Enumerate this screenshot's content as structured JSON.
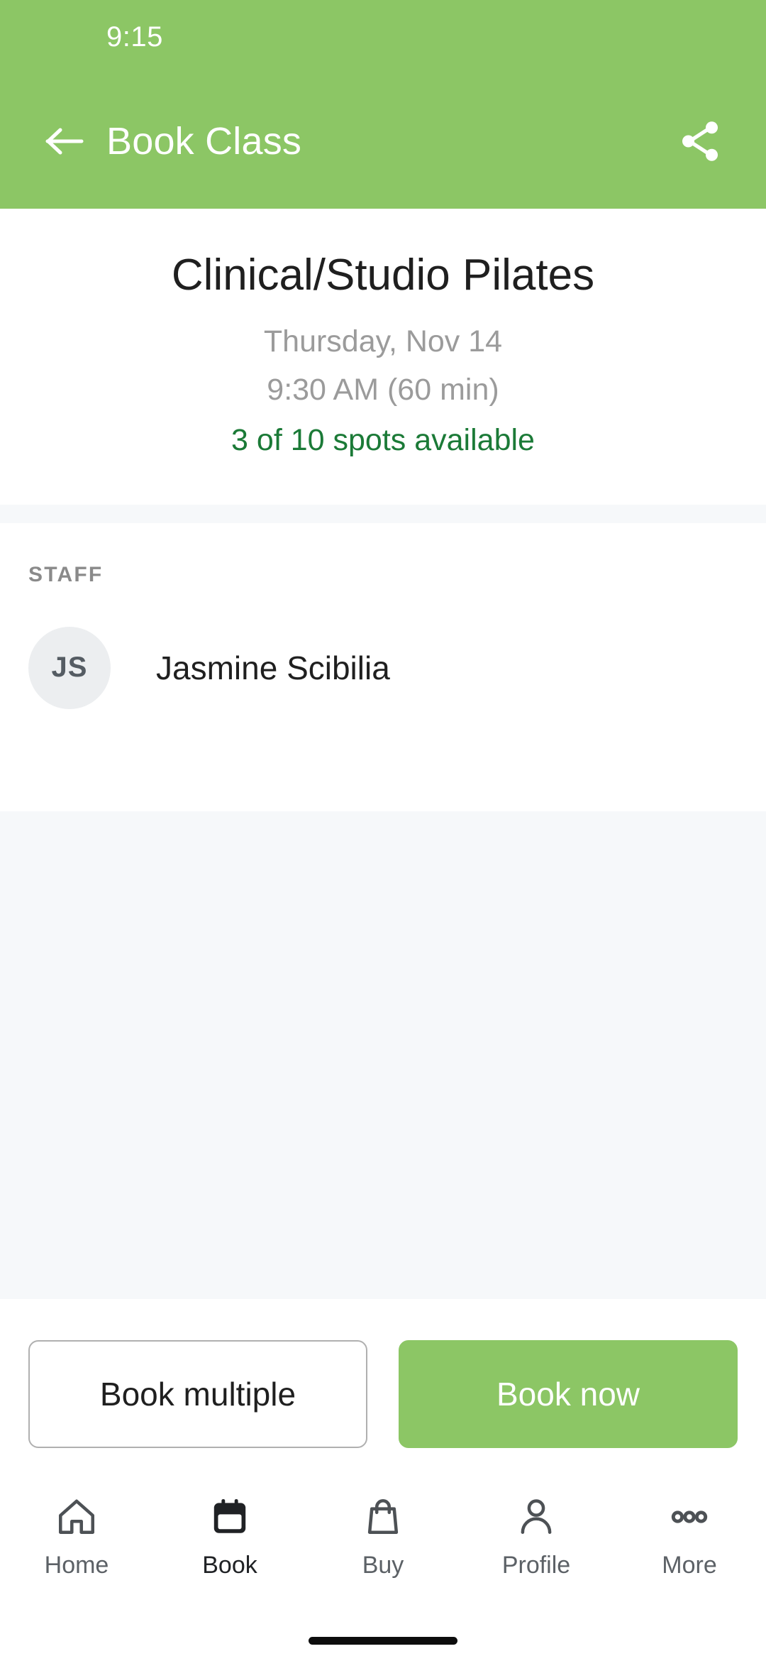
{
  "status_bar": {
    "time": "9:15"
  },
  "app_bar": {
    "back_icon": "arrow-left-icon",
    "title": "Book Class",
    "share_icon": "share-icon",
    "background_color": "#8CC665"
  },
  "class": {
    "title": "Clinical/Studio Pilates",
    "date": "Thursday, Nov 14",
    "time": "9:30 AM (60 min)",
    "availability": "3 of 10 spots available",
    "availability_color": "#1B7A37"
  },
  "staff": {
    "section_label": "STAFF",
    "members": [
      {
        "initials": "JS",
        "name": "Jasmine Scibilia"
      }
    ]
  },
  "actions": {
    "secondary_label": "Book multiple",
    "primary_label": "Book now",
    "primary_color": "#8CC665"
  },
  "bottom_nav": {
    "items": [
      {
        "label": "Home",
        "icon": "home-icon",
        "active": false
      },
      {
        "label": "Book",
        "icon": "calendar-icon",
        "active": true
      },
      {
        "label": "Buy",
        "icon": "shopping-bag-icon",
        "active": false
      },
      {
        "label": "Profile",
        "icon": "person-icon",
        "active": false
      },
      {
        "label": "More",
        "icon": "ellipsis-icon",
        "active": false
      }
    ]
  }
}
